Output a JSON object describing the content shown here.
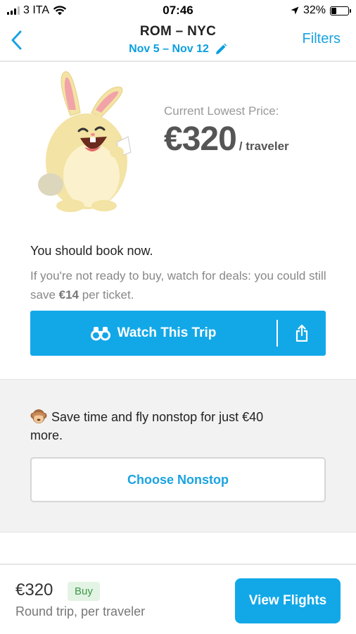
{
  "status_bar": {
    "carrier": "3 ITA",
    "time": "07:46",
    "battery": "32%"
  },
  "header": {
    "back_icon": "chevron-left-icon",
    "route": "ROM – NYC",
    "dates": "Nov 5 – Nov 12",
    "edit_icon": "pencil-icon",
    "filters_label": "Filters"
  },
  "price_info": {
    "label": "Current Lowest Price:",
    "price": "€320",
    "unit": "/ traveler"
  },
  "advice": {
    "title": "You should book now.",
    "text_before": "If you're not ready to buy, watch for deals: you could still save ",
    "savings": "€14",
    "text_after": " per ticket."
  },
  "watch_button": {
    "label": "Watch This Trip",
    "icon": "binoculars-icon",
    "share_icon": "share-icon"
  },
  "nonstop": {
    "icon": "see-no-evil-monkey-icon",
    "text": "Save time and fly nonstop for just €40 more.",
    "button_label": "Choose Nonstop"
  },
  "footer": {
    "price": "€320",
    "badge": "Buy",
    "subtitle": "Round trip, per traveler",
    "cta_label": "View Flights"
  },
  "colors": {
    "accent": "#12a8e8",
    "link": "#1aa3e0",
    "buy_badge_bg": "#e3f3e4",
    "buy_badge_text": "#3c9a48"
  }
}
